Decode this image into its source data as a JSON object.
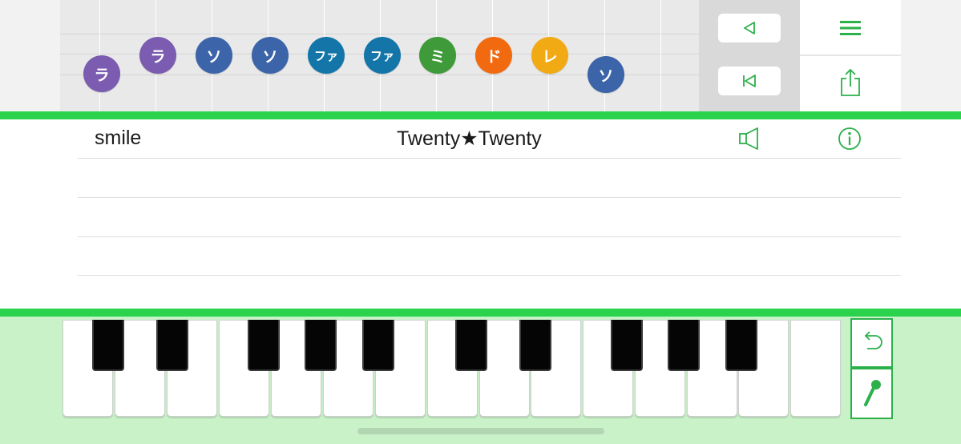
{
  "staff": {
    "notes": [
      {
        "label": "ラ",
        "color": "#7b5cb0"
      },
      {
        "label": "ラ",
        "color": "#7b5cb0"
      },
      {
        "label": "ソ",
        "color": "#3c64a8"
      },
      {
        "label": "ソ",
        "color": "#3c64a8"
      },
      {
        "label": "ファ",
        "color": "#1476a8"
      },
      {
        "label": "ファ",
        "color": "#1476a8"
      },
      {
        "label": "ミ",
        "color": "#3f9b3a"
      },
      {
        "label": "ド",
        "color": "#f26a10"
      },
      {
        "label": "レ",
        "color": "#f1aa14"
      },
      {
        "label": "ソ",
        "color": "#3c64a8"
      }
    ]
  },
  "navigation": {
    "back_icon": "play-back-triangle-icon",
    "rewind_icon": "skip-to-start-icon",
    "menu_icon": "hamburger-menu-icon",
    "share_icon": "share-icon"
  },
  "song": {
    "artist": "smile",
    "title": "Twenty★Twenty",
    "speaker_icon": "speaker-icon",
    "info_icon": "info-icon"
  },
  "keyboard": {
    "white_key_count": 15,
    "undo_icon": "undo-icon",
    "mic_icon": "microphone-icon"
  },
  "colors": {
    "accent": "#2bd34c",
    "icon_green": "#2bb04a",
    "keyboard_bg": "#c9f2c9"
  }
}
